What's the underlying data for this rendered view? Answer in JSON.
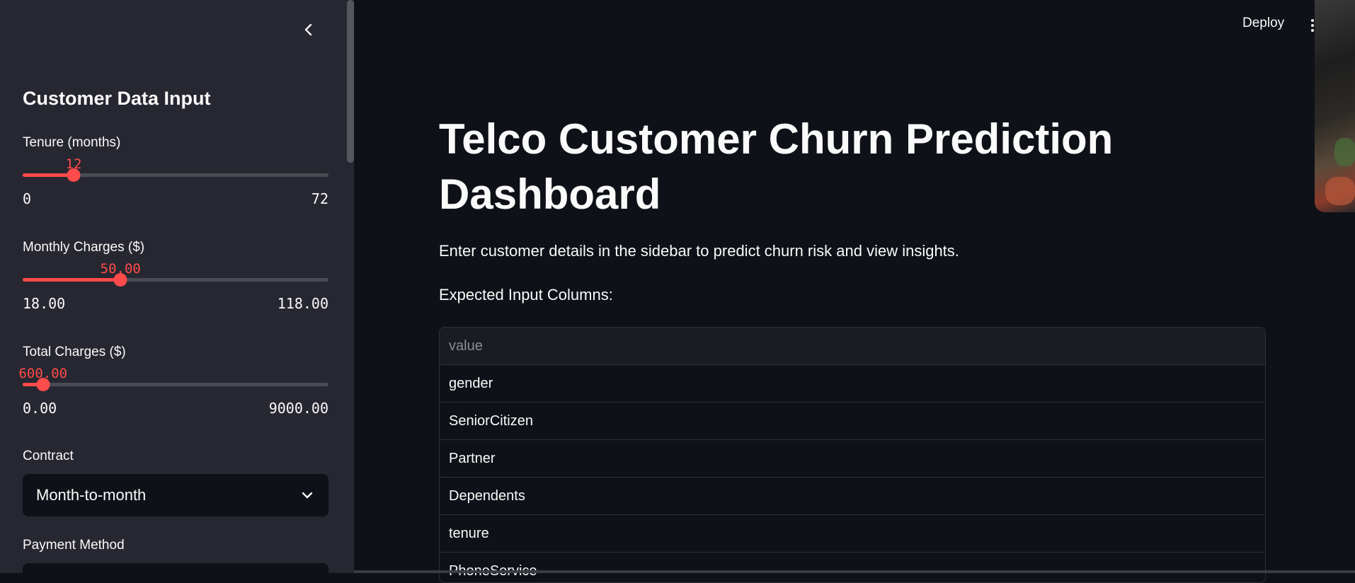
{
  "sidebar": {
    "title": "Customer Data Input",
    "sliders": [
      {
        "label": "Tenure (months)",
        "value": "12",
        "min": "0",
        "max": "72",
        "fraction": 0.1667
      },
      {
        "label": "Monthly Charges ($)",
        "value": "50.00",
        "min": "18.00",
        "max": "118.00",
        "fraction": 0.32
      },
      {
        "label": "Total Charges ($)",
        "value": "600.00",
        "min": "0.00",
        "max": "9000.00",
        "fraction": 0.0667
      }
    ],
    "contract": {
      "label": "Contract",
      "value": "Month-to-month"
    },
    "payment": {
      "label": "Payment Method"
    }
  },
  "header": {
    "deploy_label": "Deploy"
  },
  "main": {
    "title": "Telco Customer Churn Prediction Dashboard",
    "subtitle": "Enter customer details in the sidebar to predict churn risk and view insights.",
    "columns_label": "Expected Input Columns:",
    "table": {
      "header": "value",
      "rows": [
        "gender",
        "SeniorCitizen",
        "Partner",
        "Dependents",
        "tenure",
        "PhoneService"
      ]
    }
  },
  "colors": {
    "accent": "#ff4b4b",
    "sidebar_bg": "#262730",
    "main_bg": "#0e1117"
  }
}
